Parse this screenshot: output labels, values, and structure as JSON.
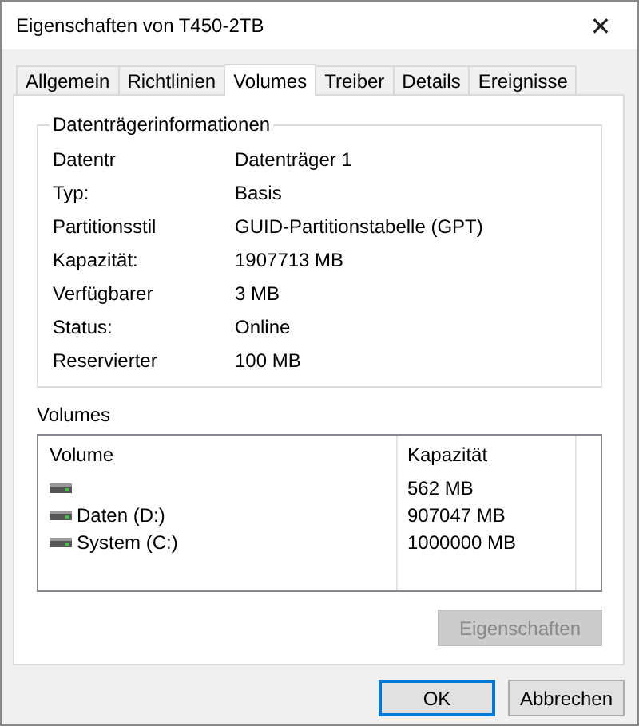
{
  "window": {
    "title": "Eigenschaften von T450-2TB",
    "close": "✕"
  },
  "tabs": [
    {
      "label": "Allgemein",
      "selected": false
    },
    {
      "label": "Richtlinien",
      "selected": false
    },
    {
      "label": "Volumes",
      "selected": true
    },
    {
      "label": "Treiber",
      "selected": false
    },
    {
      "label": "Details",
      "selected": false
    },
    {
      "label": "Ereignisse",
      "selected": false
    }
  ],
  "disk_info": {
    "title": "Datenträgerinformationen",
    "rows": [
      {
        "label": "Datentr",
        "value": "Datenträger 1"
      },
      {
        "label": "Typ:",
        "value": "Basis"
      },
      {
        "label": "Partitionsstil",
        "value": "GUID-Partitionstabelle (GPT)"
      },
      {
        "label": "Kapazität:",
        "value": "1907713 MB"
      },
      {
        "label": "Verfügbarer",
        "value": "3 MB"
      },
      {
        "label": "Status:",
        "value": "Online"
      },
      {
        "label": "Reservierter",
        "value": "100 MB"
      }
    ]
  },
  "volumes": {
    "title": "Volumes",
    "columns": [
      "Volume",
      "Kapazität"
    ],
    "rows": [
      {
        "volume": "",
        "capacity": "562 MB"
      },
      {
        "volume": "Daten (D:)",
        "capacity": "907047 MB"
      },
      {
        "volume": "System (C:)",
        "capacity": "1000000 MB"
      }
    ]
  },
  "properties_button": {
    "label": "Eigenschaften",
    "disabled": true
  },
  "buttons": [
    {
      "label": "OK",
      "default": true
    },
    {
      "label": "Abbrechen",
      "default": false
    }
  ]
}
